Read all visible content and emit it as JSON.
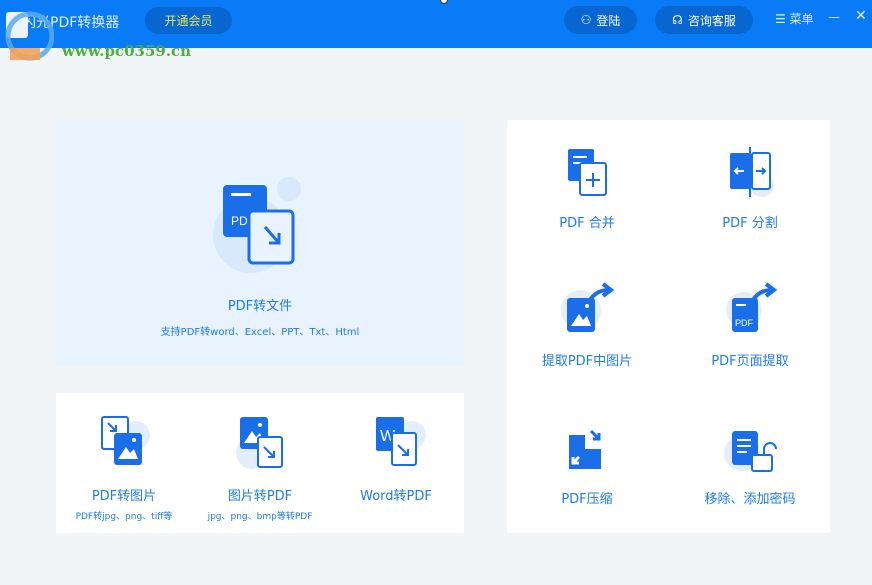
{
  "header": {
    "app_title": "闪光PDF转换器",
    "vip_label": "开通会员",
    "login_label": "登陆",
    "service_label": "咨询客服",
    "menu_label": "菜单",
    "watermark": "www.pc0359.cn"
  },
  "main": {
    "title": "PDF转文件",
    "subtitle": "支持PDF转word、Excel、PPT、Txt、Html"
  },
  "bottom": [
    {
      "title": "PDF转图片",
      "sub": "PDF转jpg、png、tiff等"
    },
    {
      "title": "图片转PDF",
      "sub": "jpg、png、bmp等转PDF"
    },
    {
      "title": "Word转PDF",
      "sub": ""
    }
  ],
  "right": [
    {
      "title": "PDF 合并"
    },
    {
      "title": "PDF 分割"
    },
    {
      "title": "提取PDF中图片"
    },
    {
      "title": "PDF页面提取"
    },
    {
      "title": "PDF压缩"
    },
    {
      "title": "移除、添加密码"
    }
  ],
  "colors": {
    "header": "#0a7bf7",
    "accent": "#1f7ce6"
  }
}
